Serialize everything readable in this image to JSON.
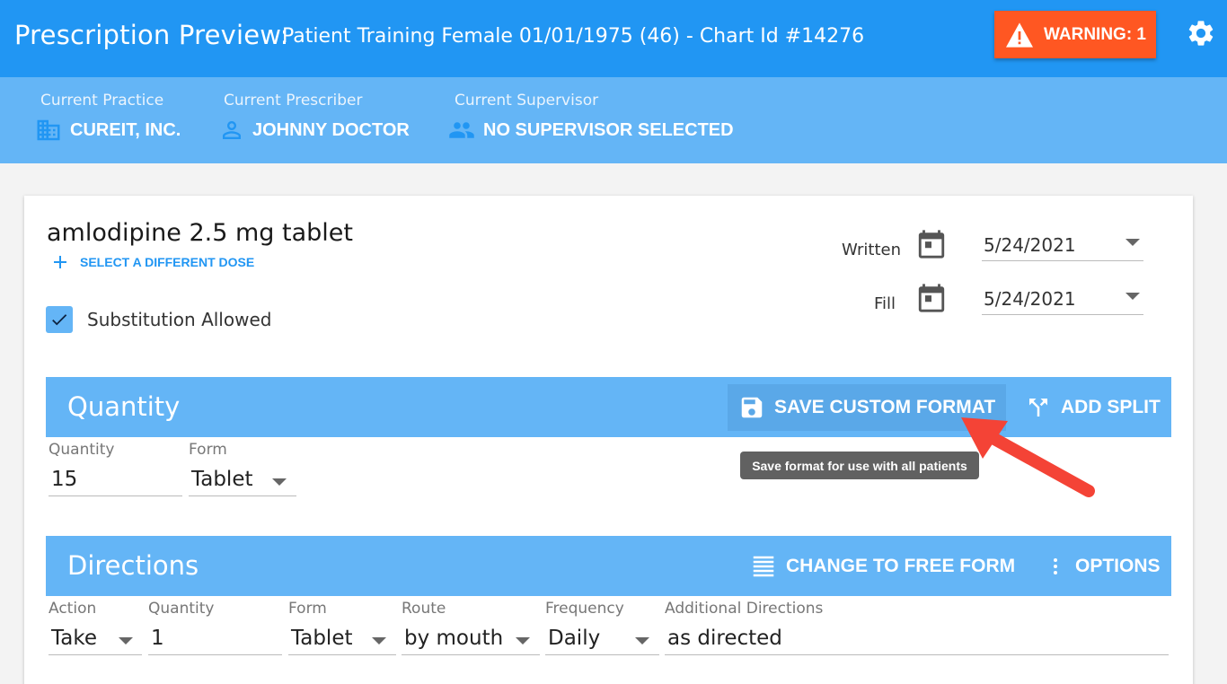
{
  "header": {
    "title": "Prescription Preview:",
    "patient": "Patient Training Female 01/01/1975 (46) - Chart Id #14276",
    "warning_label": "WARNING: 1",
    "settings_icon": "gear-icon"
  },
  "context": {
    "practice": {
      "label": "Current Practice",
      "value": "CUREIT, INC."
    },
    "prescriber": {
      "label": "Current Prescriber",
      "value": "JOHNNY DOCTOR"
    },
    "supervisor": {
      "label": "Current Supervisor",
      "value": "NO SUPERVISOR SELECTED"
    }
  },
  "drug": {
    "name": "amlodipine 2.5 mg tablet",
    "select_dose_label": "SELECT A DIFFERENT DOSE",
    "substitution_label": "Substitution Allowed",
    "substitution_checked": true
  },
  "dates": {
    "written": {
      "label": "Written",
      "value": "5/24/2021"
    },
    "fill": {
      "label": "Fill",
      "value": "5/24/2021"
    }
  },
  "quantity_section": {
    "title": "Quantity",
    "save_format_label": "SAVE CUSTOM FORMAT",
    "add_split_label": "ADD SPLIT",
    "quantity": {
      "label": "Quantity",
      "value": "15"
    },
    "form": {
      "label": "Form",
      "value": "Tablet"
    }
  },
  "tooltip": "Save format for use with all patients",
  "directions_section": {
    "title": "Directions",
    "free_form_label": "CHANGE TO FREE FORM",
    "options_label": "OPTIONS",
    "action": {
      "label": "Action",
      "value": "Take"
    },
    "quantity": {
      "label": "Quantity",
      "value": "1"
    },
    "form": {
      "label": "Form",
      "value": "Tablet"
    },
    "route": {
      "label": "Route",
      "value": "by mouth"
    },
    "frequency": {
      "label": "Frequency",
      "value": "Daily"
    },
    "additional": {
      "label": "Additional Directions",
      "value": "as directed"
    }
  },
  "colors": {
    "primary": "#2196f3",
    "light_primary": "#64b5f6",
    "warning": "#ff5722",
    "annotation_arrow": "#f44336"
  }
}
